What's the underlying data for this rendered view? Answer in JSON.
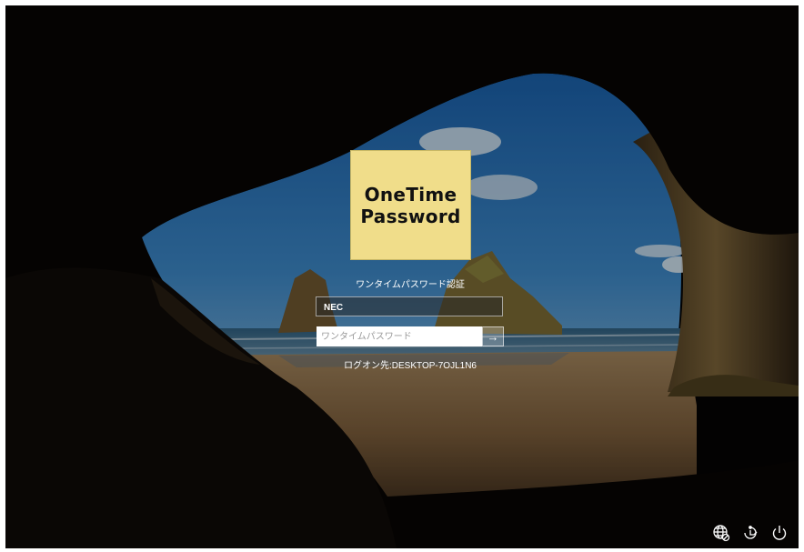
{
  "logo": {
    "line1": "OneTime",
    "line2": "Password"
  },
  "auth_title": "ワンタイムパスワード認証",
  "username": {
    "value": "NEC"
  },
  "password": {
    "placeholder": "ワンタイムパスワード",
    "value": ""
  },
  "submit": {
    "icon": "arrow-right-icon",
    "glyph": "→"
  },
  "logon_target": "ログオン先:DESKTOP-7OJL1N6",
  "tray": {
    "icons": [
      "network-icon",
      "ease-of-access-icon",
      "power-icon"
    ]
  },
  "colors": {
    "logo_bg": "#f0dd8a",
    "text": "#ffffff"
  }
}
